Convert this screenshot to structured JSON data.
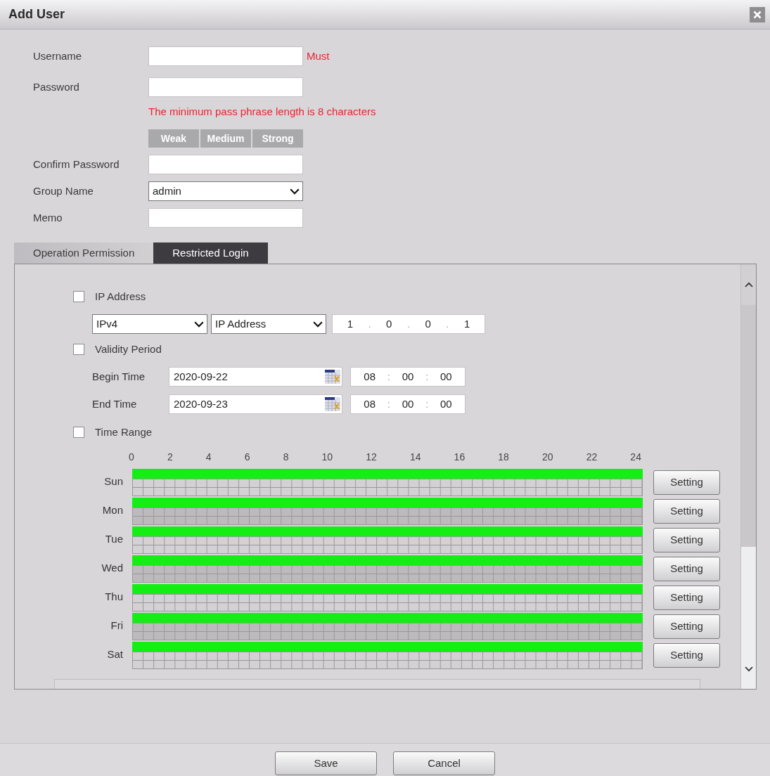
{
  "window": {
    "title": "Add User"
  },
  "form": {
    "fields": [
      {
        "kind": "text",
        "label": "Username",
        "note": "Must"
      },
      {
        "kind": "password",
        "label": "Password",
        "hint": "The minimum pass phrase length is 8 characters",
        "strength": [
          {
            "label": "Weak",
            "selected": false
          },
          {
            "label": "Medium",
            "selected": false
          },
          {
            "label": "Strong",
            "selected": false
          }
        ]
      },
      {
        "kind": "password",
        "label": "Confirm Password"
      },
      {
        "kind": "select",
        "label": "Group Name",
        "value": "admin"
      },
      {
        "kind": "text",
        "label": "Memo"
      }
    ]
  },
  "tabs": [
    {
      "label": "Operation Permission",
      "selected": false
    },
    {
      "label": "Restricted Login",
      "selected": true
    }
  ],
  "restricted_login": {
    "ip_address": {
      "label": "IP Address",
      "checked": false,
      "version": "IPv4",
      "match": "IP Address",
      "octets": [
        "1",
        "0",
        "0",
        "1"
      ],
      "separator": "."
    },
    "validity_period": {
      "label": "Validity Period",
      "checked": false,
      "clock_separator": ":",
      "times": [
        {
          "label": "Begin Time",
          "date": "2020-09-22",
          "clock": [
            "08",
            "00",
            "00"
          ]
        },
        {
          "label": "End Time",
          "date": "2020-09-23",
          "clock": [
            "08",
            "00",
            "00"
          ]
        }
      ]
    },
    "time_range": {
      "label": "Time Range",
      "checked": false,
      "hours": [
        "0",
        "2",
        "4",
        "6",
        "8",
        "10",
        "12",
        "14",
        "16",
        "18",
        "20",
        "22",
        "24"
      ],
      "days": [
        {
          "label": "Sun",
          "level": 1,
          "button": "Setting"
        },
        {
          "label": "Mon",
          "level": 1,
          "button": "Setting"
        },
        {
          "label": "Tue",
          "level": 1,
          "button": "Setting"
        },
        {
          "label": "Wed",
          "level": 1,
          "button": "Setting"
        },
        {
          "label": "Thu",
          "level": 1,
          "button": "Setting"
        },
        {
          "label": "Fri",
          "level": 1,
          "button": "Setting"
        },
        {
          "label": "Sat",
          "level": 1,
          "button": "Setting"
        }
      ]
    }
  },
  "buttons": [
    {
      "label": "Save"
    },
    {
      "label": "Cancel"
    }
  ]
}
